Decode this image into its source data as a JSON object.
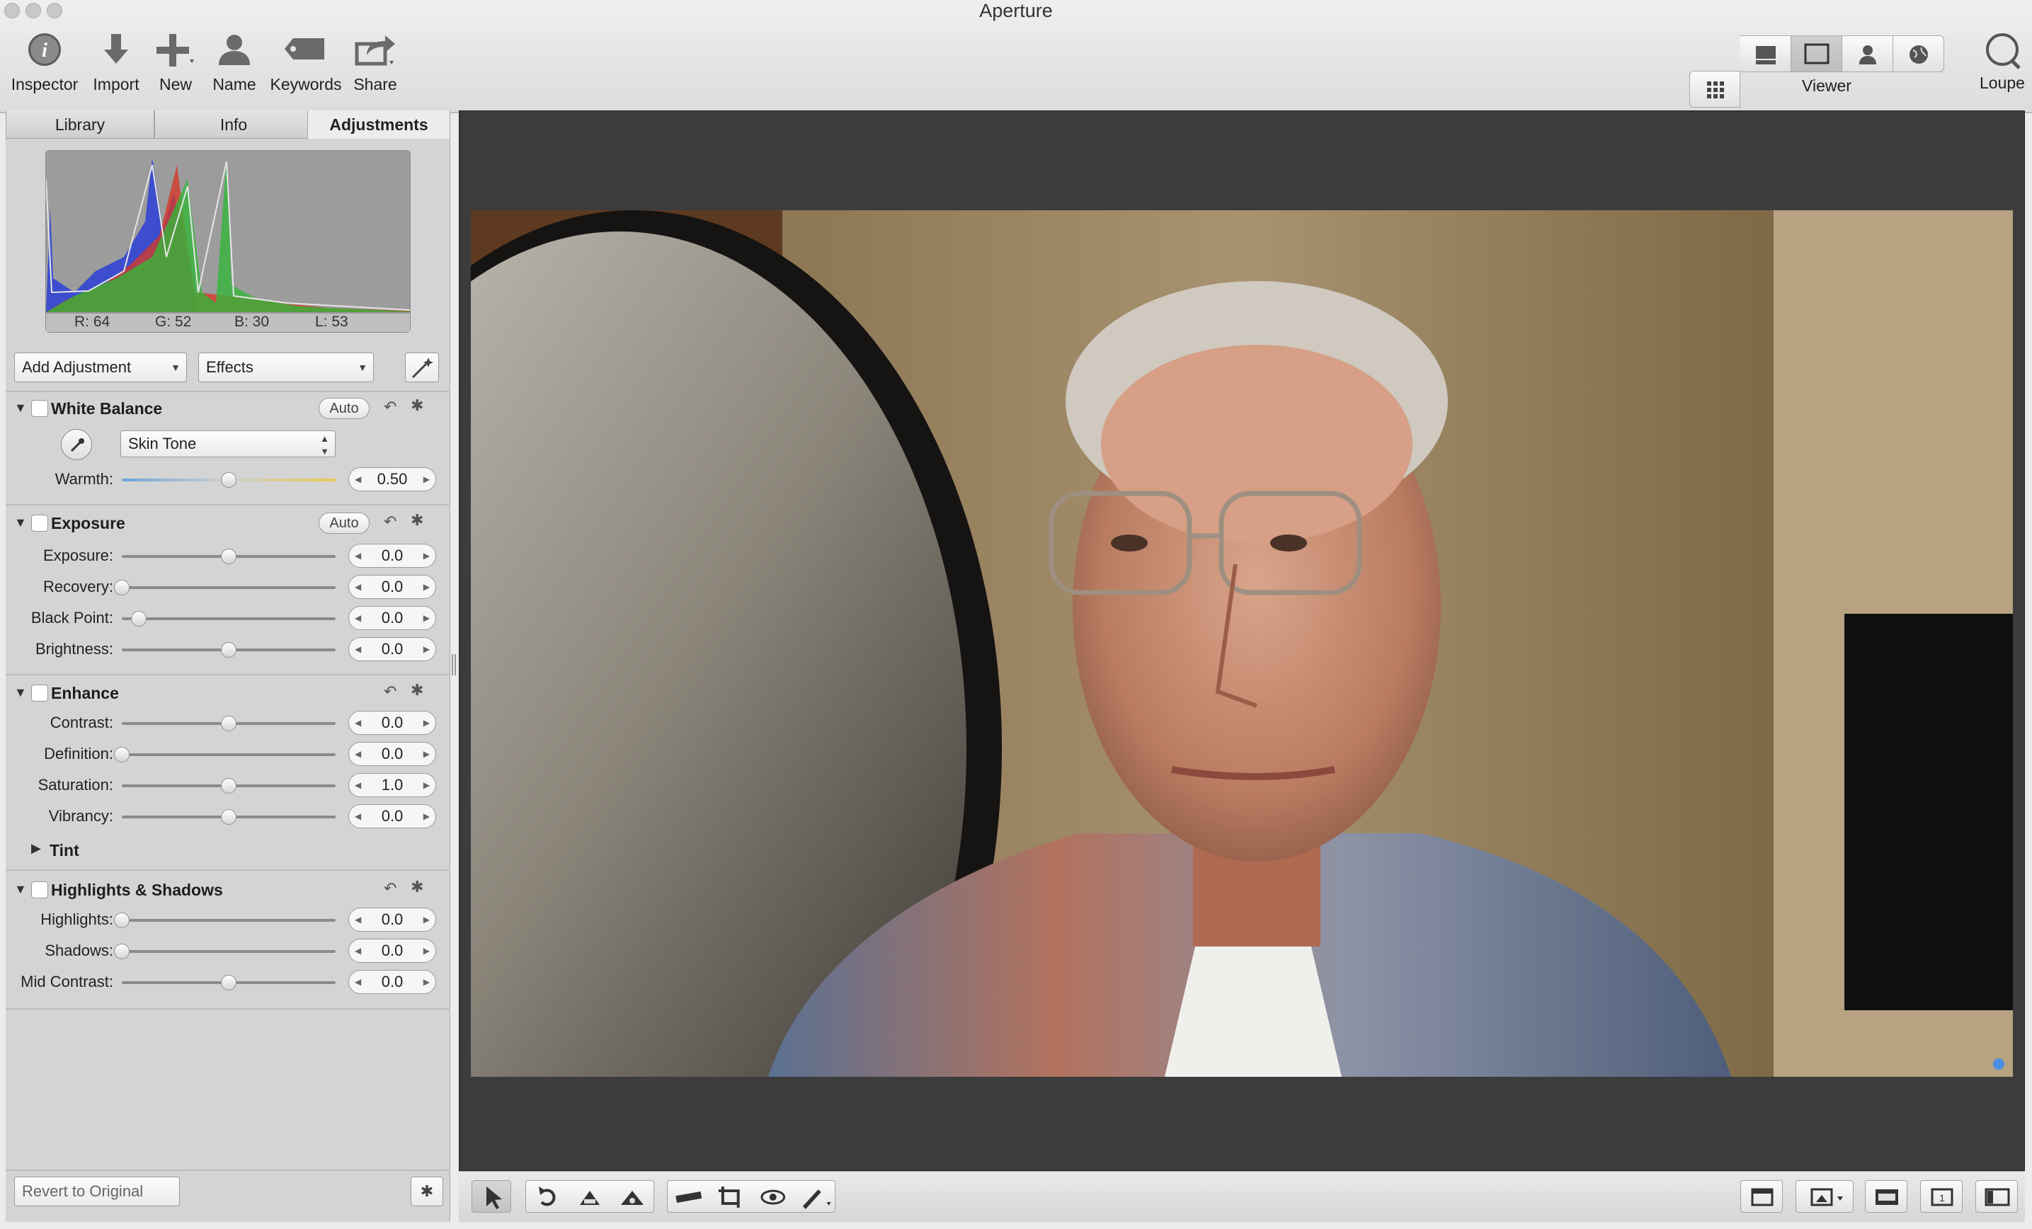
{
  "app": {
    "title": "Aperture"
  },
  "toolbar": {
    "inspector": "Inspector",
    "import": "Import",
    "new": "New",
    "name": "Name",
    "keywords": "Keywords",
    "share": "Share",
    "viewer": "Viewer",
    "loupe": "Loupe"
  },
  "tabs": [
    {
      "label": "Library",
      "icon": "library-tab"
    },
    {
      "label": "Info",
      "icon": "info-tab"
    },
    {
      "label": "Adjustments",
      "icon": "adjustments-tab",
      "active": true
    }
  ],
  "histogram": {
    "r": "R: 64",
    "g": "G: 52",
    "b": "B: 30",
    "l": "L: 53"
  },
  "adjust_controls": {
    "add_adjustment": "Add Adjustment",
    "effects": "Effects"
  },
  "white_balance": {
    "title": "White Balance",
    "auto": "Auto",
    "mode": "Skin Tone",
    "warmth_label": "Warmth:",
    "warmth_value": "0.50",
    "warmth_fraction": 0.5
  },
  "exposure": {
    "title": "Exposure",
    "auto": "Auto",
    "sliders": [
      {
        "label": "Exposure:",
        "value": "0.0",
        "pos": 0.5
      },
      {
        "label": "Recovery:",
        "value": "0.0",
        "pos": 0.0
      },
      {
        "label": "Black Point:",
        "value": "0.0",
        "pos": 0.08
      },
      {
        "label": "Brightness:",
        "value": "0.0",
        "pos": 0.5
      }
    ]
  },
  "enhance": {
    "title": "Enhance",
    "sliders": [
      {
        "label": "Contrast:",
        "value": "0.0",
        "pos": 0.5
      },
      {
        "label": "Definition:",
        "value": "0.0",
        "pos": 0.0
      },
      {
        "label": "Saturation:",
        "value": "1.0",
        "pos": 0.5
      },
      {
        "label": "Vibrancy:",
        "value": "0.0",
        "pos": 0.5
      }
    ],
    "tint": "Tint"
  },
  "highlights_shadows": {
    "title": "Highlights & Shadows",
    "sliders": [
      {
        "label": "Highlights:",
        "value": "0.0",
        "pos": 0.0
      },
      {
        "label": "Shadows:",
        "value": "0.0",
        "pos": 0.0
      },
      {
        "label": "Mid Contrast:",
        "value": "0.0",
        "pos": 0.5
      }
    ]
  },
  "footer": {
    "revert": "Revert to Original"
  },
  "colors": {
    "accent": "#4a90e2",
    "viewer_bg": "#3c3c3c"
  }
}
